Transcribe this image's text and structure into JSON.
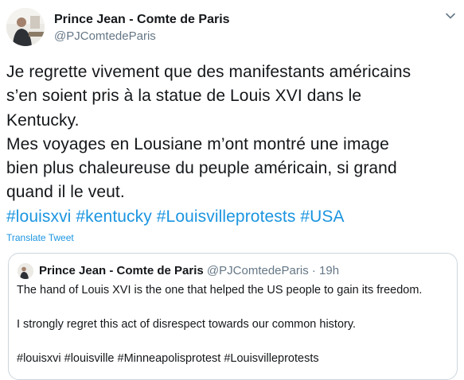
{
  "author": {
    "name": "Prince Jean - Comte de Paris",
    "handle": "@PJComtedeParis"
  },
  "tweet": {
    "lines": [
      "Je regrette vivement que des manifestants américains",
      "s’en soient pris à la statue de Louis XVI dans le",
      "Kentucky.",
      "Mes voyages en Lousiane m’ont montré une image",
      "bien plus chaleureuse du peuple américain, si grand",
      "quand il le veut."
    ],
    "hashtags": [
      "#louisxvi",
      "#kentucky",
      "#Louisvilleprotests",
      "#USA"
    ]
  },
  "translate_label": "Translate Tweet",
  "quoted": {
    "name": "Prince Jean - Comte de Paris",
    "handle": "@PJComtedeParis",
    "separator": "·",
    "time": "19h",
    "paragraphs": [
      "The hand of Louis XVI is the one that helped the US people to gain its freedom.",
      "I strongly regret this act of disrespect towards our common history.",
      "#louisxvi #louisville #Minneapolisprotest #Louisvilleprotests"
    ]
  },
  "icons": {
    "menu": "chevron-down-icon",
    "avatar": "profile-photo"
  },
  "colors": {
    "link": "#1b95e0",
    "text": "#14171a",
    "secondary": "#657786",
    "border": "#ccd6dd"
  }
}
